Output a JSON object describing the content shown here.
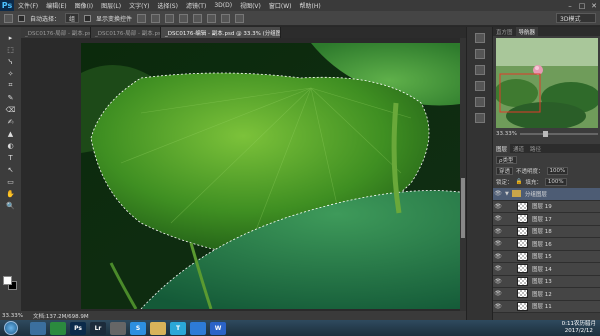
{
  "menubar": {
    "logo": "Ps",
    "items": [
      "文件(F)",
      "编辑(E)",
      "图像(I)",
      "图层(L)",
      "文字(Y)",
      "选择(S)",
      "滤镜(T)",
      "3D(D)",
      "视图(V)",
      "窗口(W)",
      "帮助(H)"
    ]
  },
  "options": {
    "auto_select_label": "自动选择：",
    "auto_select_value": "组",
    "show_transform_label": "显示变换控件",
    "workspace": "3D模式"
  },
  "tabs": [
    "_DSC0176-局部 - 副本.psd @ 14.8%(1个...",
    "_DSC0176-局部 - 副本.psd @ 12.5% (图层 44, RG...",
    "_DSC0176-编辑 - 副本.psd @ 33.3% (分组图层, RGB/16*)"
  ],
  "tools": [
    "▸",
    "⬚",
    "ᓭ",
    "✧",
    "⌗",
    "✎",
    "⌫",
    "✍",
    "▲",
    "◐",
    "T",
    "↖",
    "▭",
    "✋",
    "🔍"
  ],
  "status": {
    "zoom": "33.33%",
    "doc": "文档:137.2M/698.9M"
  },
  "panels": {
    "tabs": [
      "直方图",
      "导航器"
    ],
    "zoom": "33.33%",
    "layers_tabs": [
      "图层",
      "通道",
      "路径"
    ],
    "kind_label": "ρ类型",
    "blend_mode": "穿透",
    "opacity_label": "不透明度：",
    "opacity": "100%",
    "lock_label": "锁定：",
    "fill_label": "填充：",
    "fill": "100%",
    "group_name": "分组图层",
    "layers": [
      "图层 19",
      "图层 17",
      "图层 18",
      "图层 16",
      "图层 15",
      "图层 14",
      "图层 13",
      "图层 12",
      "图层 11"
    ]
  },
  "taskbar": {
    "apps": [
      {
        "label": "",
        "color": "#3b6f9e"
      },
      {
        "label": "",
        "color": "#2b8a3e"
      },
      {
        "label": "Ps",
        "color": "#0b2a4a"
      },
      {
        "label": "Lr",
        "color": "#1c2b3b"
      },
      {
        "label": "",
        "color": "#666"
      },
      {
        "label": "S",
        "color": "#2d8fe0"
      },
      {
        "label": "",
        "color": "#d8b35a"
      },
      {
        "label": "T",
        "color": "#2aa7d8"
      },
      {
        "label": "",
        "color": "#2d7bd6"
      },
      {
        "label": "W",
        "color": "#2b63c7"
      }
    ],
    "time": "0:11农历腊月",
    "date": "2017/2/12"
  }
}
